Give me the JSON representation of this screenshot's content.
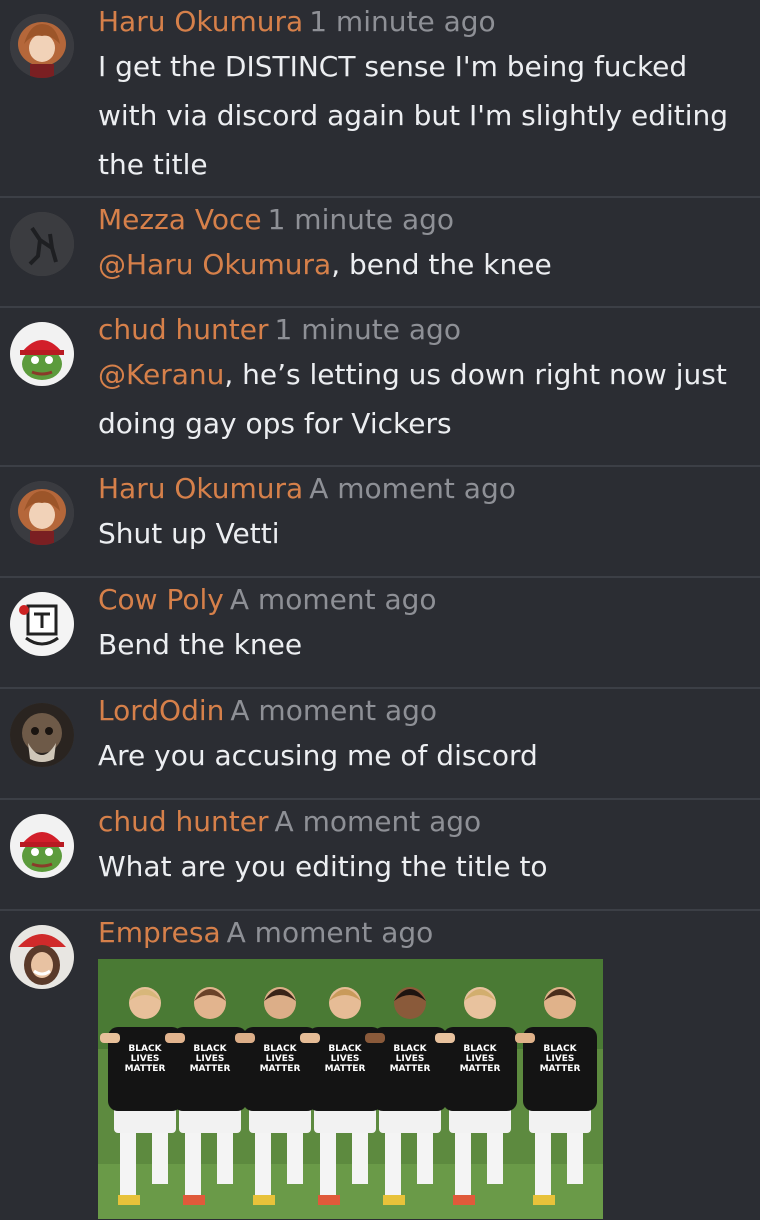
{
  "colors": {
    "background": "#2b2d33",
    "divider": "#3c3f46",
    "author": "#d6804a",
    "mention": "#d6804a",
    "timestamp": "#8e9096",
    "text": "#eceef1"
  },
  "comments": [
    {
      "author": "Haru Okumura",
      "time": "1 minute ago",
      "avatar_icon": "haru-avatar-icon",
      "mention": "",
      "text": "I get the DISTINCT sense I'm being fucked with via discord again but I'm slightly editing the title"
    },
    {
      "author": "Mezza Voce",
      "time": "1 minute ago",
      "avatar_icon": "mezza-avatar-icon",
      "mention": "@Haru Okumura",
      "text": ", bend the knee"
    },
    {
      "author": "chud hunter",
      "time": "1 minute ago",
      "avatar_icon": "pepe-avatar-icon",
      "mention": "@Keranu",
      "text": ", he’s letting us down right now just doing gay ops for Vickers"
    },
    {
      "author": "Haru Okumura",
      "time": "A moment ago",
      "avatar_icon": "haru-avatar-icon",
      "mention": "",
      "text": "Shut up Vetti"
    },
    {
      "author": "Cow Poly",
      "time": "A moment ago",
      "avatar_icon": "cowpoly-avatar-icon",
      "mention": "",
      "text": "Bend the knee"
    },
    {
      "author": "LordOdin",
      "time": "A moment ago",
      "avatar_icon": "odin-avatar-icon",
      "mention": "",
      "text": "Are you accusing me of discord"
    },
    {
      "author": "chud hunter",
      "time": "A moment ago",
      "avatar_icon": "pepe-avatar-icon",
      "mention": "",
      "text": "What are you editing the title to"
    },
    {
      "author": "Empresa",
      "time": "A moment ago",
      "avatar_icon": "empresa-avatar-icon",
      "mention": "",
      "text": "",
      "image": {
        "shirt_text": [
          "BLACK",
          "LIVES",
          "MATTER"
        ]
      }
    }
  ]
}
